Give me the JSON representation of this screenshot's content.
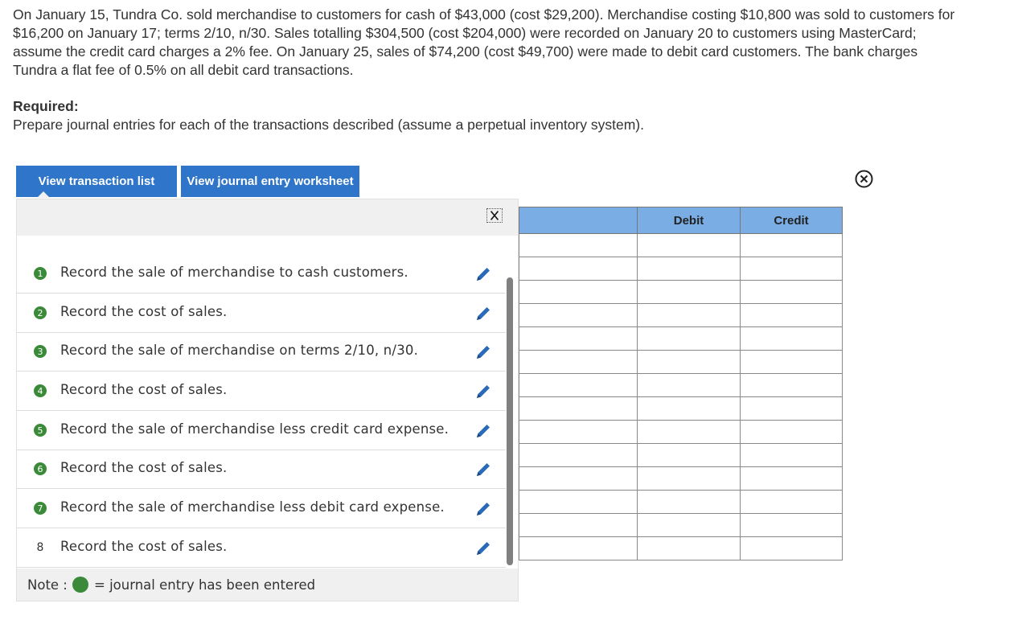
{
  "problem": {
    "text": "On January 15, Tundra Co. sold merchandise to customers for cash of $43,000 (cost $29,200). Merchandise costing $10,800 was sold to customers for $16,200 on January 17; terms 2/10, n/30. Sales totalling $304,500 (cost $204,000) were recorded on January 20 to customers using MasterCard; assume the credit card charges a 2% fee. On January 25, sales of $74,200 (cost $49,700) were made to debit card customers. The bank charges Tundra a flat fee of 0.5% on all debit card transactions."
  },
  "required": {
    "title": "Required:",
    "text": "Prepare journal entries for each of the transactions described (assume a perpetual inventory system)."
  },
  "tabs": {
    "transaction_list": "View transaction list",
    "journal_worksheet": "View journal entry worksheet"
  },
  "transactions": [
    {
      "num": "1",
      "text": "Record the sale of merchandise to cash customers.",
      "entered": true
    },
    {
      "num": "2",
      "text": "Record the cost of sales.",
      "entered": true
    },
    {
      "num": "3",
      "text": "Record the sale of merchandise on terms 2/10, n/30.",
      "entered": true
    },
    {
      "num": "4",
      "text": "Record the cost of sales.",
      "entered": true
    },
    {
      "num": "5",
      "text": "Record the sale of merchandise less credit card expense.",
      "entered": true
    },
    {
      "num": "6",
      "text": "Record the cost of sales.",
      "entered": true
    },
    {
      "num": "7",
      "text": "Record the sale of merchandise less debit card expense.",
      "entered": true
    },
    {
      "num": "8",
      "text": "Record the cost of sales.",
      "entered": false
    }
  ],
  "note": {
    "label": "Note :",
    "text": "= journal entry has been entered"
  },
  "journal": {
    "headers": [
      "",
      "Debit",
      "Credit"
    ],
    "row_count": 14
  },
  "colors": {
    "primary_button": "#2f75c9",
    "entered_green": "#3a8a3a",
    "table_header": "#7aade4",
    "pencil_blue": "#2a6ab8"
  },
  "icons": {
    "close": "close-circle-icon",
    "edit": "pencil-icon",
    "panel_close": "x-icon"
  }
}
